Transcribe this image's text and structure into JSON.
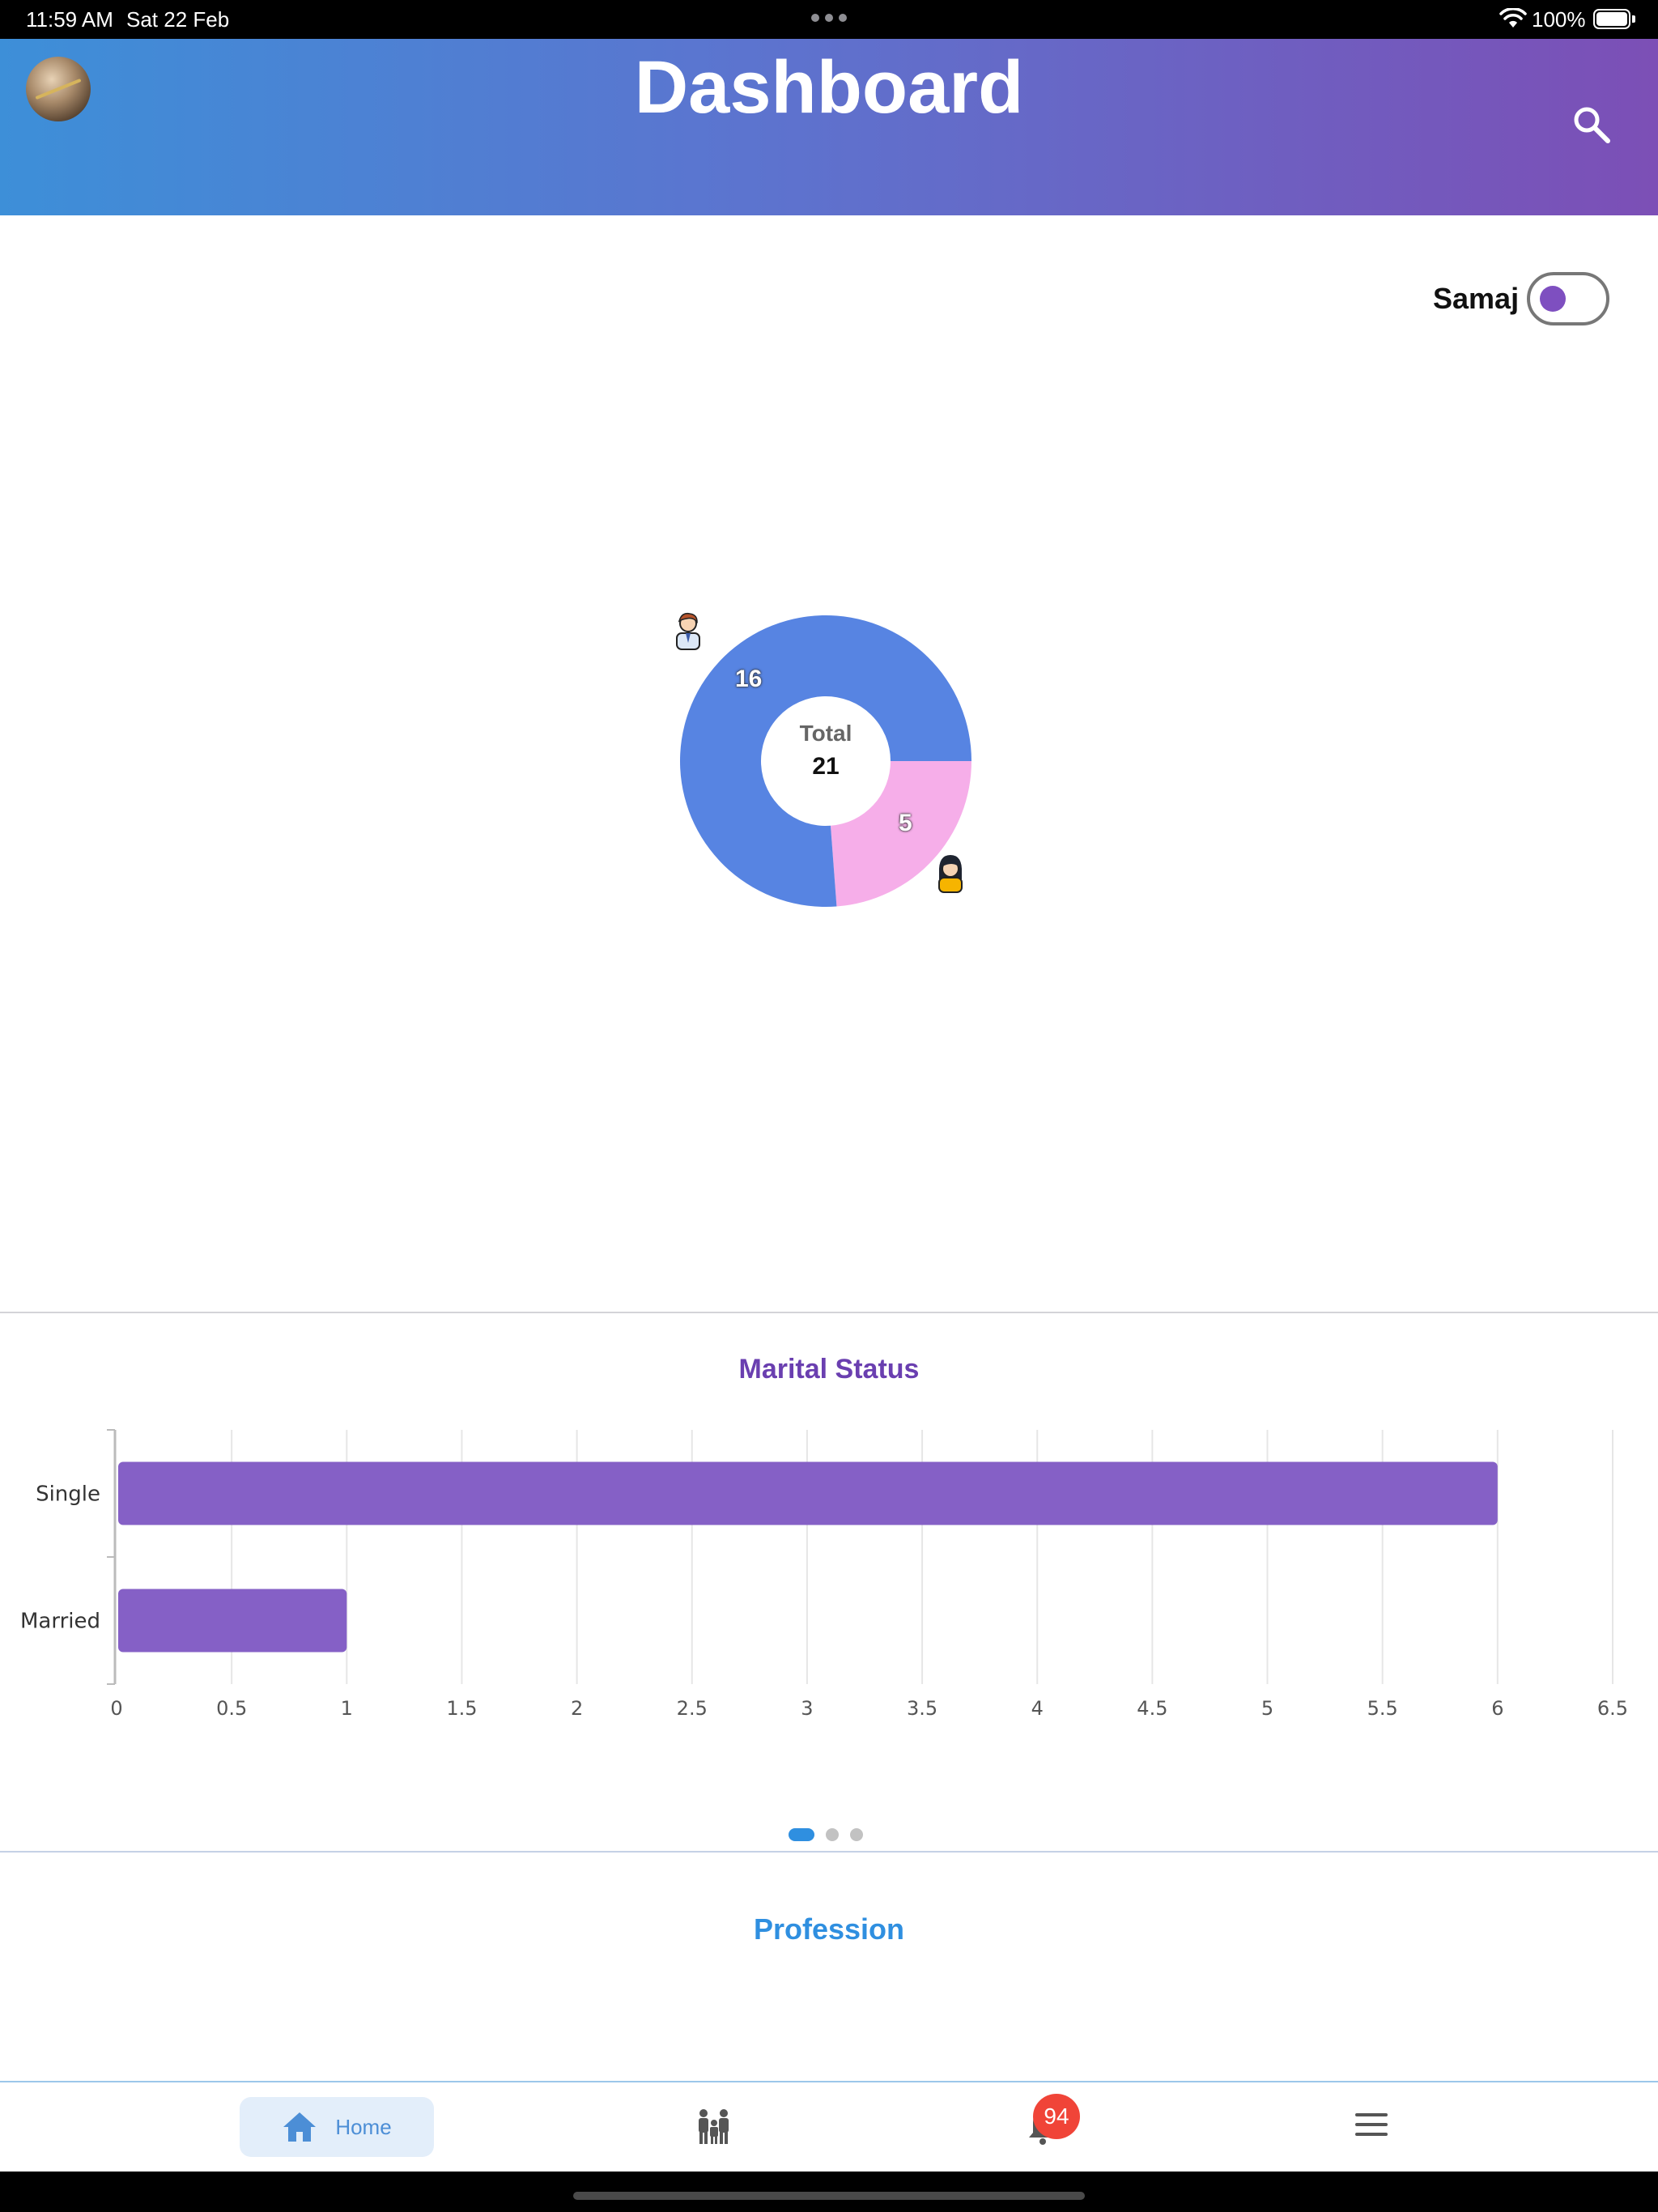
{
  "status_bar": {
    "time": "11:59 AM",
    "date": "Sat 22 Feb",
    "battery": "100%",
    "icons": [
      "more-dots-icon",
      "wifi-icon",
      "battery-icon"
    ]
  },
  "header": {
    "title": "Dashboard",
    "avatar_icon": "avatar",
    "search_icon": "search-icon",
    "gradient_start": "#3d8fd8",
    "gradient_end": "#7c4fb6"
  },
  "toggle": {
    "label": "Samaj",
    "state": "off",
    "accent": "#7e4fc0"
  },
  "gender_chart": {
    "center_label": "Total",
    "center_value": "21",
    "male_label": "16",
    "female_label": "5"
  },
  "chart_data": [
    {
      "type": "pie",
      "variant": "donut",
      "center_text": [
        "Total",
        "21"
      ],
      "slices": [
        {
          "value": 16,
          "label": "16",
          "icon": "male-avatar-icon",
          "color": "#5784e2"
        },
        {
          "value": 5,
          "label": "5",
          "icon": "female-avatar-icon",
          "color": "#f6aee9"
        }
      ]
    },
    {
      "type": "bar",
      "orientation": "horizontal",
      "title": "Marital Status",
      "categories": [
        "Single",
        "Married"
      ],
      "values": [
        6,
        1
      ],
      "xlim": [
        0,
        6.5
      ],
      "x_ticks": [
        "0",
        "0.5",
        "1",
        "1.5",
        "2",
        "2.5",
        "3",
        "3.5",
        "4",
        "4.5",
        "5",
        "5.5",
        "6",
        "6.5"
      ],
      "grid": true,
      "color": "#8560c6"
    }
  ],
  "pager": {
    "count": 3,
    "active": 0
  },
  "sections": {
    "profession_title": "Profession"
  },
  "bottom_nav": {
    "home_label": "Home",
    "home_icon": "home-icon",
    "family_icon": "family-icon",
    "bell_icon": "bell-icon",
    "notifications_badge": "94",
    "menu_icon": "menu-icon",
    "active_color": "#4c8ed6"
  }
}
